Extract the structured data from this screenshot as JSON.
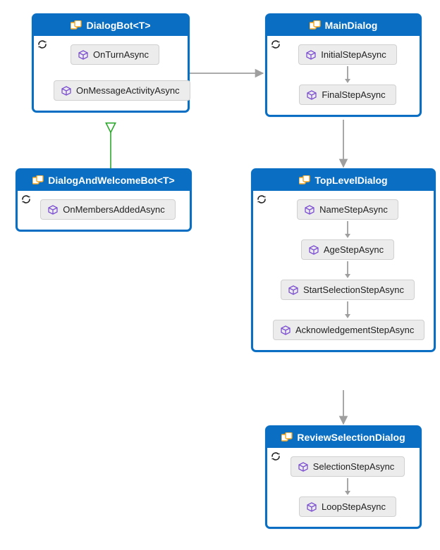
{
  "boxes": {
    "dialogBot": {
      "title": "DialogBot<T>",
      "methods": [
        "OnTurnAsync",
        "OnMessageActivityAsync"
      ]
    },
    "dialogAndWelcome": {
      "title": "DialogAndWelcomeBot<T>",
      "methods": [
        "OnMembersAddedAsync"
      ]
    },
    "mainDialog": {
      "title": "MainDialog",
      "methods": [
        "InitialStepAsync",
        "FinalStepAsync"
      ]
    },
    "topLevelDialog": {
      "title": "TopLevelDialog",
      "methods": [
        "NameStepAsync",
        "AgeStepAsync",
        "StartSelectionStepAsync",
        "AcknowledgementStepAsync"
      ]
    },
    "reviewSelection": {
      "title": "ReviewSelectionDialog",
      "methods": [
        "SelectionStepAsync",
        "LoopStepAsync"
      ]
    }
  }
}
